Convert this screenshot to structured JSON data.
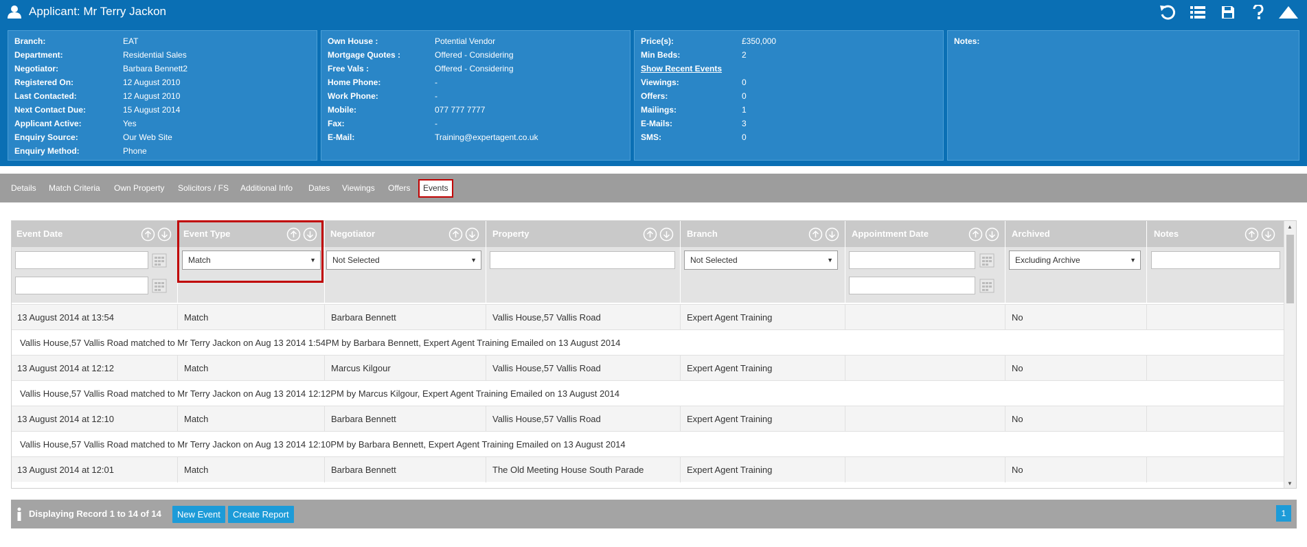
{
  "header": {
    "title": "Applicant: Mr Terry Jackon",
    "icons": [
      "user-icon",
      "undo-icon",
      "list-icon",
      "save-icon",
      "help-icon",
      "collapse-up-icon"
    ]
  },
  "panel1": [
    {
      "label": "Branch:",
      "value": "EAT"
    },
    {
      "label": "Department:",
      "value": "Residential Sales"
    },
    {
      "label": "Negotiator:",
      "value": "Barbara Bennett2"
    },
    {
      "label": "Registered On:",
      "value": "12 August 2010"
    },
    {
      "label": "Last Contacted:",
      "value": "12 August 2010"
    },
    {
      "label": "Next Contact Due:",
      "value": "15 August 2014"
    },
    {
      "label": "Applicant Active:",
      "value": "Yes"
    },
    {
      "label": "Enquiry Source:",
      "value": "Our Web Site"
    },
    {
      "label": "Enquiry Method:",
      "value": "Phone"
    }
  ],
  "panel2": [
    {
      "label": "Own House :",
      "value": "Potential Vendor"
    },
    {
      "label": "Mortgage Quotes :",
      "value": "Offered - Considering"
    },
    {
      "label": "Free Vals :",
      "value": "Offered - Considering"
    },
    {
      "label": "Home Phone:",
      "value": "-"
    },
    {
      "label": "Work Phone:",
      "value": "-"
    },
    {
      "label": "Mobile:",
      "value": "077 777 7777"
    },
    {
      "label": "Fax:",
      "value": "-"
    },
    {
      "label": "E-Mail:",
      "value": "Training@expertagent.co.uk"
    }
  ],
  "panel3": {
    "price_label": "Price(s):",
    "price_value": "£350,000",
    "minbeds_label": "Min Beds:",
    "minbeds_value": "2",
    "show_recent": "Show Recent Events",
    "rows": [
      {
        "label": "Viewings:",
        "value": "0"
      },
      {
        "label": "Offers:",
        "value": "0"
      },
      {
        "label": "Mailings:",
        "value": "1"
      },
      {
        "label": "E-Mails:",
        "value": "3"
      },
      {
        "label": "SMS:",
        "value": "0"
      }
    ]
  },
  "panel4": {
    "label": "Notes:"
  },
  "tabs": [
    "Details",
    "Match Criteria",
    "Own Property",
    "Solicitors / FS",
    "Additional Info",
    "Dates",
    "Viewings",
    "Offers",
    "Events"
  ],
  "active_tab": "Events",
  "grid": {
    "columns": [
      "Event Date",
      "Event Type",
      "Negotiator",
      "Property",
      "Branch",
      "Appointment Date",
      "Archived",
      "Notes"
    ],
    "filters": {
      "event_type": "Match",
      "negotiator": "Not Selected",
      "branch": "Not Selected",
      "archived": "Excluding Archive"
    },
    "rows": [
      {
        "date": "13 August 2014 at 13:54",
        "type": "Match",
        "negotiator": "Barbara Bennett",
        "property": "Vallis House,57 Vallis Road",
        "branch": "Expert Agent Training",
        "appointment": "",
        "archived": "No",
        "notes": "",
        "detail": "Vallis House,57 Vallis Road matched to Mr Terry Jackon on Aug 13 2014 1:54PM by Barbara Bennett, Expert Agent Training Emailed on 13 August 2014"
      },
      {
        "date": "13 August 2014 at 12:12",
        "type": "Match",
        "negotiator": "Marcus Kilgour",
        "property": "Vallis House,57 Vallis Road",
        "branch": "Expert Agent Training",
        "appointment": "",
        "archived": "No",
        "notes": "",
        "detail": "Vallis House,57 Vallis Road matched to Mr Terry Jackon on Aug 13 2014 12:12PM by Marcus Kilgour, Expert Agent Training Emailed on 13 August 2014"
      },
      {
        "date": "13 August 2014 at 12:10",
        "type": "Match",
        "negotiator": "Barbara Bennett",
        "property": "Vallis House,57 Vallis Road",
        "branch": "Expert Agent Training",
        "appointment": "",
        "archived": "No",
        "notes": "",
        "detail": "Vallis House,57 Vallis Road matched to Mr Terry Jackon on Aug 13 2014 12:10PM by Barbara Bennett, Expert Agent Training Emailed on 13 August 2014"
      },
      {
        "date": "13 August 2014 at 12:01",
        "type": "Match",
        "negotiator": "Barbara Bennett",
        "property": "The Old Meeting House South Parade",
        "branch": "Expert Agent Training",
        "appointment": "",
        "archived": "No",
        "notes": "",
        "detail": ""
      }
    ]
  },
  "footer": {
    "info": "Displaying Record 1 to 14 of 14",
    "new_event": "New Event",
    "create_report": "Create Report",
    "page": "1"
  }
}
